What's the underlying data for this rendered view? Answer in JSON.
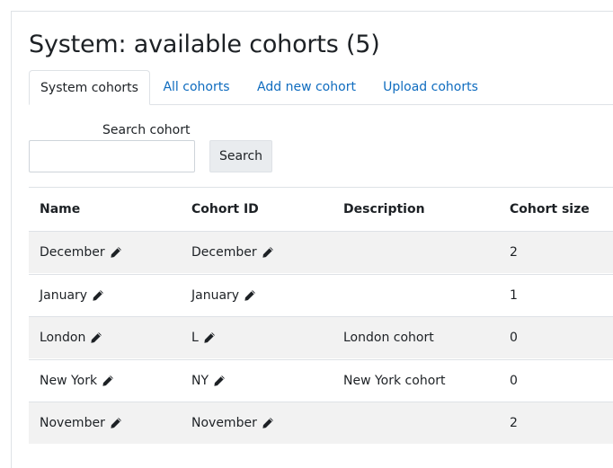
{
  "page": {
    "title": "System: available cohorts (5)"
  },
  "tabs": [
    {
      "label": "System cohorts",
      "active": true
    },
    {
      "label": "All cohorts",
      "active": false
    },
    {
      "label": "Add new cohort",
      "active": false
    },
    {
      "label": "Upload cohorts",
      "active": false
    }
  ],
  "search": {
    "label": "Search cohort",
    "value": "",
    "button_label": "Search"
  },
  "table": {
    "headers": [
      "Name",
      "Cohort ID",
      "Description",
      "Cohort size"
    ],
    "rows": [
      {
        "name": "December",
        "cohort_id": "December",
        "description": "",
        "size": "2"
      },
      {
        "name": "January",
        "cohort_id": "January",
        "description": "",
        "size": "1"
      },
      {
        "name": "London",
        "cohort_id": "L",
        "description": "London cohort",
        "size": "0"
      },
      {
        "name": "New York",
        "cohort_id": "NY",
        "description": "New York cohort",
        "size": "0"
      },
      {
        "name": "November",
        "cohort_id": "November",
        "description": "",
        "size": "2"
      }
    ]
  },
  "icons": {
    "edit": "pencil-icon"
  },
  "colors": {
    "link": "#0f6cbf",
    "stripe": "#f2f2f2",
    "border": "#dee2e6"
  }
}
